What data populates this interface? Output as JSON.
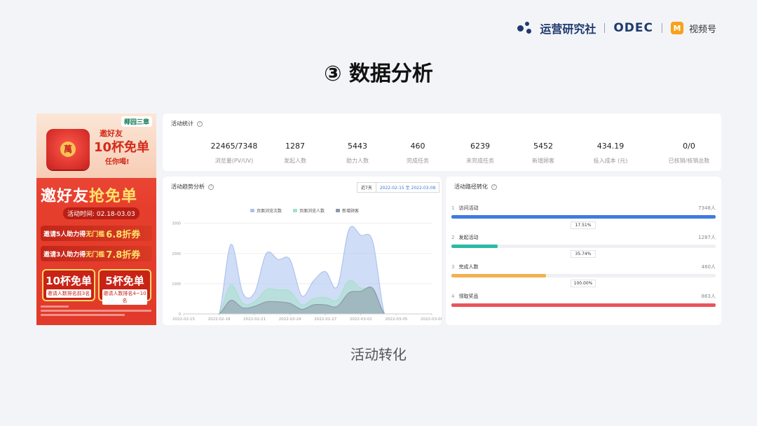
{
  "brand": {
    "name": "运营研究社",
    "partner": "ODEC",
    "channel": "视频号",
    "channel_icon": "M"
  },
  "page_title": "③ 数据分析",
  "caption": "活动转化",
  "poster": {
    "logo": "椰园三章",
    "invite_small": "邀好友",
    "free_big": "10杯免单",
    "take": "任你喝!",
    "headline_a": "邀好友",
    "headline_b": "抢免单",
    "period": "活动时间: 02.18-03.03",
    "deal1_pre": "邀请5人助力得",
    "deal1_mid": "无门槛",
    "deal1_em": "6.8折券",
    "deal2_pre": "邀请3人助力得",
    "deal2_mid": "无门槛",
    "deal2_em": "7.8折券",
    "card1_big": "10杯免单",
    "card1_sub": "邀请人数排名前3名",
    "card2_big": "5杯免单",
    "card2_sub": "邀请人数排名4~10名"
  },
  "stats": {
    "title": "活动统计",
    "items": [
      {
        "value": "22465/7348",
        "label": "浏览量(PV/UV)"
      },
      {
        "value": "1287",
        "label": "发起人数"
      },
      {
        "value": "5443",
        "label": "助力人数"
      },
      {
        "value": "460",
        "label": "完成任务"
      },
      {
        "value": "6239",
        "label": "未完成任务"
      },
      {
        "value": "5452",
        "label": "新增顾客"
      },
      {
        "value": "434.19",
        "label": "投入成本 (元)"
      },
      {
        "value": "0/0",
        "label": "已核销/核销总数"
      }
    ]
  },
  "trend": {
    "title": "活动趋势分析",
    "range_preset": "近7天",
    "range_dates": "2022-02-15 至 2022-03-08"
  },
  "chart_data": {
    "type": "area",
    "title": "活动趋势分析",
    "x": [
      "2022-02-15",
      "2022-02-16",
      "2022-02-17",
      "2022-02-18",
      "2022-02-19",
      "2022-02-20",
      "2022-02-21",
      "2022-02-22",
      "2022-02-23",
      "2022-02-24",
      "2022-02-25",
      "2022-02-26",
      "2022-02-27",
      "2022-02-28",
      "2022-03-01",
      "2022-03-02",
      "2022-03-03",
      "2022-03-04",
      "2022-03-05",
      "2022-03-06",
      "2022-03-07",
      "2022-03-08"
    ],
    "x_ticks": [
      "2022-02-15",
      "2022-02-18",
      "2022-02-21",
      "2022-02-24",
      "2022-02-27",
      "2022-03-02",
      "2022-03-05",
      "2022-03-08"
    ],
    "y_ticks": [
      0,
      1000,
      2000,
      3000
    ],
    "ylim": [
      0,
      3200
    ],
    "grid": true,
    "legend_position": "top",
    "series": [
      {
        "name": "页面浏览次数",
        "color": "#a9c1ee",
        "values": [
          0,
          0,
          0,
          0,
          2300,
          700,
          700,
          2000,
          1800,
          1800,
          600,
          1100,
          1400,
          900,
          2800,
          2600,
          2400,
          0,
          0,
          0,
          0,
          0
        ]
      },
      {
        "name": "页面浏览人数",
        "color": "#a5e0c9",
        "values": [
          0,
          0,
          0,
          0,
          950,
          350,
          400,
          800,
          800,
          750,
          300,
          500,
          550,
          450,
          1100,
          850,
          800,
          0,
          0,
          0,
          0,
          0
        ]
      },
      {
        "name": "新增顾客",
        "color": "#8d97a8",
        "values": [
          0,
          0,
          0,
          0,
          450,
          200,
          250,
          400,
          400,
          350,
          150,
          300,
          300,
          250,
          700,
          750,
          850,
          0,
          0,
          0,
          0,
          0
        ]
      }
    ]
  },
  "funnel": {
    "title": "活动路径转化",
    "steps": [
      {
        "index": "1",
        "name": "访问活动",
        "count": "7348人",
        "ratio": 1.0,
        "color": "#3e7be0"
      },
      {
        "index": "2",
        "name": "发起活动",
        "count": "1287人",
        "ratio": 0.1751,
        "color": "#2fb9a6"
      },
      {
        "index": "3",
        "name": "完成人数",
        "count": "460人",
        "ratio": 0.3574,
        "color": "#f3b04c"
      },
      {
        "index": "4",
        "name": "领取奖品",
        "count": "863人",
        "ratio": 1.0,
        "color": "#e8555a"
      }
    ],
    "rates": [
      "17.51%",
      "35.74%",
      "100.00%"
    ]
  }
}
